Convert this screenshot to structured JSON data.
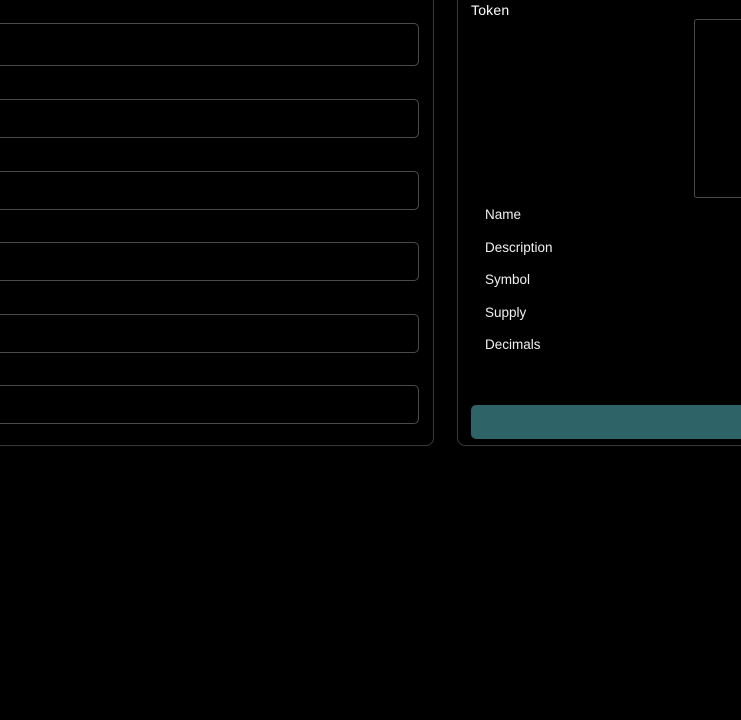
{
  "form": {
    "fields": [
      {
        "value": "",
        "placeholder": ""
      },
      {
        "value": "",
        "placeholder": ""
      },
      {
        "value": "",
        "placeholder": ""
      },
      {
        "value": "",
        "placeholder": ""
      },
      {
        "value": "",
        "placeholder": ""
      },
      {
        "value": "",
        "placeholder": ""
      }
    ]
  },
  "preview": {
    "title": "Token",
    "labels": [
      "Name",
      "Description",
      "Symbol",
      "Supply",
      "Decimals"
    ],
    "button_label": ""
  },
  "colors": {
    "background": "#000000",
    "accent": "#2e6467",
    "border": "#3a3a3a"
  }
}
